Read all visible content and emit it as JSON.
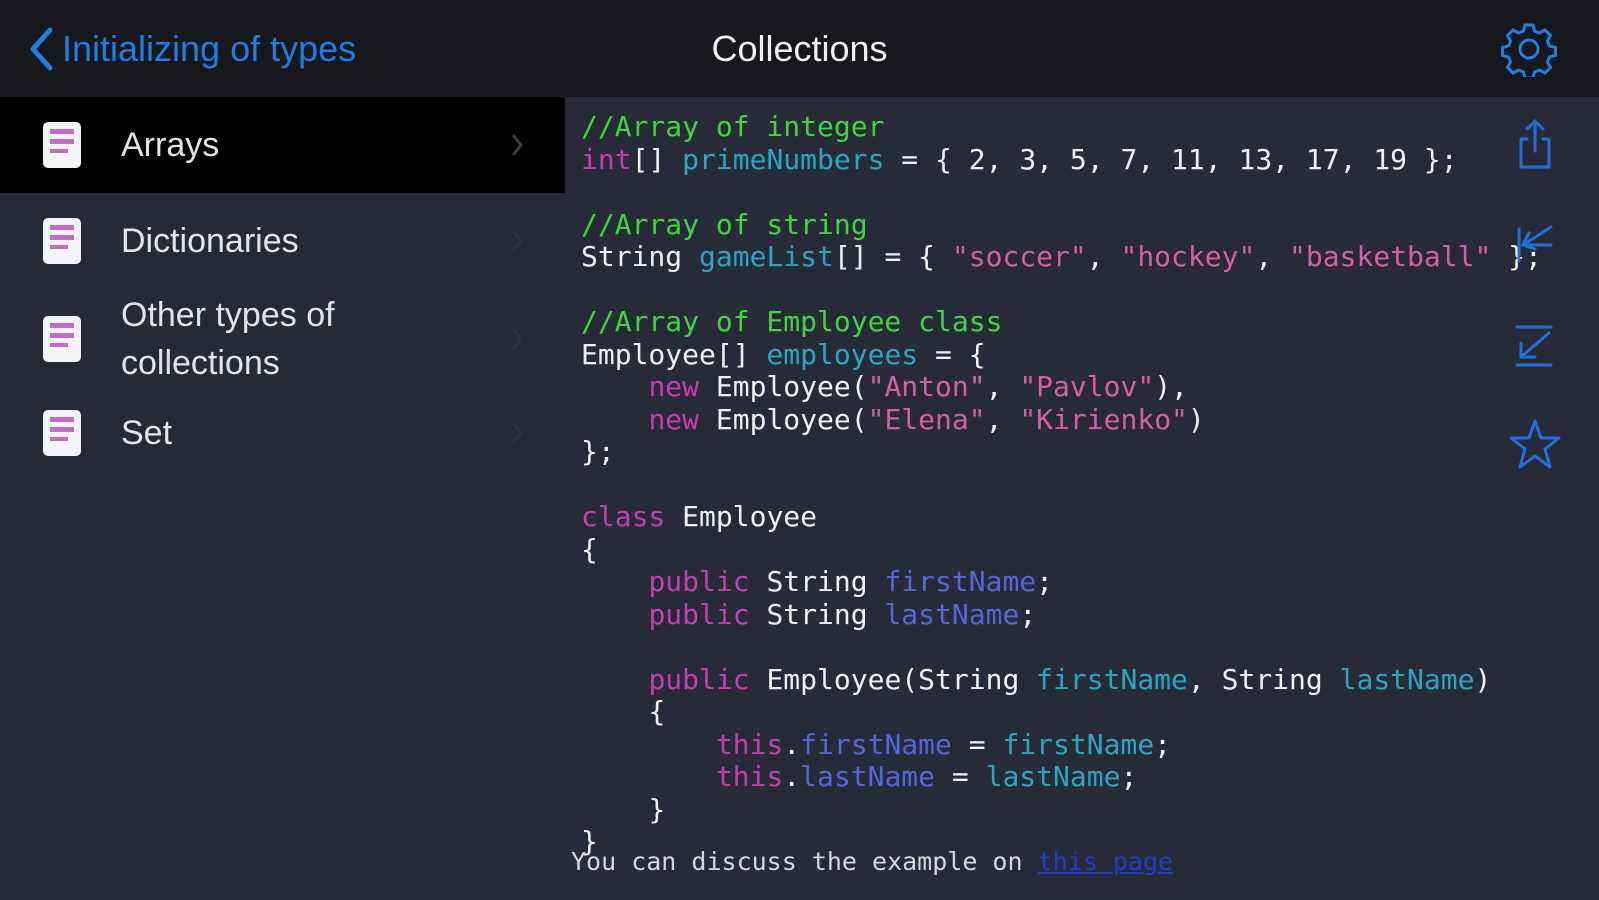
{
  "navbar": {
    "back_label": "Initializing of types",
    "title": "Collections",
    "settings_icon": "gear-icon",
    "accent": "#1f7de6"
  },
  "sidebar": {
    "items": [
      {
        "label": "Arrays",
        "selected": true,
        "icon": "code-document-icon"
      },
      {
        "label": "Dictionaries",
        "selected": false,
        "icon": "code-document-icon"
      },
      {
        "label": "Other types of\ncollections",
        "selected": false,
        "icon": "code-document-icon"
      },
      {
        "label": "Set",
        "selected": false,
        "icon": "code-document-icon"
      }
    ]
  },
  "code": {
    "comment1": "//Array of integer",
    "kw_int": "int",
    "l2_a": "[] ",
    "var_primes": "primeNumbers",
    "l2_b": " = { 2, 3, 5, 7, 11, 13, 17, 19 };",
    "comment2": "//Array of string",
    "l4_a": "String ",
    "var_gamelist": "gameList",
    "l4_b": "[] = { ",
    "str_soccer": "\"soccer\"",
    "comma": ", ",
    "str_hockey": "\"hockey\"",
    "str_basketball": "\"basketball\"",
    "l4_end": " };",
    "comment3": "//Array of Employee class",
    "l6_a": "Employee[] ",
    "var_employees": "employees",
    "l6_b": " = {",
    "indent1": "    ",
    "kw_new": "new",
    "employee_call": " Employee(",
    "str_anton": "\"Anton\"",
    "str_pavlov": "\"Pavlov\"",
    "l7_end": "),",
    "str_elena": "\"Elena\"",
    "str_kirienko": "\"Kirienko\"",
    "l8_end": ")",
    "l9": "};",
    "kw_class": "class",
    "class_name": " Employee",
    "brace_open": "{",
    "brace_close": "}",
    "kw_public": "public",
    "type_string": " String ",
    "field_first": "firstName",
    "field_last": "lastName",
    "semi": ";",
    "ctor_a": " Employee(String ",
    "ctor_b": ", String ",
    "ctor_end": ")",
    "indent2": "        ",
    "kw_this": "this",
    "dot": ".",
    "assign": " = "
  },
  "footer": {
    "text": "You can discuss the example on ",
    "link": "this page"
  },
  "side_icons": [
    "share-icon",
    "first-page-icon",
    "last-page-icon",
    "star-icon"
  ]
}
